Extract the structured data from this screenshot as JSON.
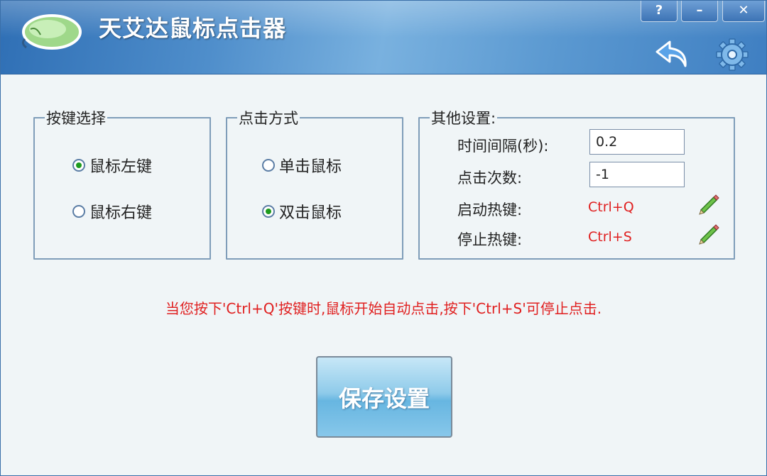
{
  "window": {
    "title": "天艾达鼠标点击器"
  },
  "controls": {
    "help": "?",
    "minimize": "–",
    "close": "✕"
  },
  "groups": {
    "button_select": {
      "legend": "按键选择",
      "options": [
        {
          "label": "鼠标左键",
          "checked": true
        },
        {
          "label": "鼠标右键",
          "checked": false
        }
      ]
    },
    "click_mode": {
      "legend": "点击方式",
      "options": [
        {
          "label": "单击鼠标",
          "checked": false
        },
        {
          "label": "双击鼠标",
          "checked": true
        }
      ]
    },
    "other": {
      "legend": "其他设置:",
      "interval_label": "时间间隔(秒):",
      "interval_value": "0.2",
      "count_label": "点击次数:",
      "count_value": "-1",
      "start_hotkey_label": "启动热键:",
      "start_hotkey": "Ctrl+Q",
      "stop_hotkey_label": "停止热键:",
      "stop_hotkey": "Ctrl+S"
    }
  },
  "notice": "当您按下'Ctrl+Q'按键时,鼠标开始自动点击,按下'Ctrl+S'可停止点击.",
  "save_label": "保存设置",
  "icons": {
    "logo": "mouse-icon",
    "back": "back-arrow-icon",
    "settings": "gear-icon",
    "edit": "pencil-icon"
  },
  "colors": {
    "accent": "#3f7fc2",
    "hotkey": "#e02020",
    "radio_dot": "#1e9b1e"
  }
}
